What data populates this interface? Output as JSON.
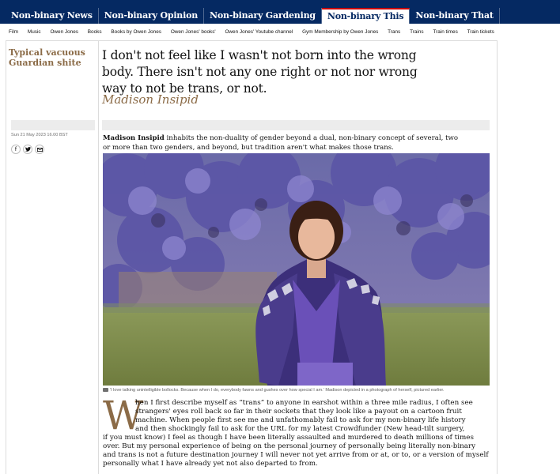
{
  "nav": {
    "pillars": [
      {
        "label": "Non-binary News"
      },
      {
        "label": "Non-binary Opinion"
      },
      {
        "label": "Non-binary Gardening"
      },
      {
        "label": "Non-binary This"
      },
      {
        "label": "Non-binary That"
      }
    ],
    "active_pillar": "Non-binary This",
    "subnav": [
      "Film",
      "Music",
      "Owen Jones",
      "Books",
      "Books by Owen Jones",
      "Owen Jones' books'",
      "Owen Jones' Youtube channel",
      "Gym Membership by Owen Jones",
      "Trans",
      "Trains",
      "Train times",
      "Train tickets"
    ]
  },
  "article": {
    "series": "Typical vacuous Guardian shite",
    "headline": "I don't not feel like I wasn't not born into the wrong body. There isn't not any one right or not nor wrong way to not be trans, or not.",
    "byline": "Madison Insipid",
    "date": "Sun 21 May 2023 16.00 BST",
    "share_icons": [
      "facebook-icon",
      "twitter-icon",
      "email-icon"
    ],
    "standfirst_name": "Madison Insipid",
    "standfirst_rest": " inhabits the non-duality of gender beyond a dual, non-binary concept of several, two or more than two genders, and beyond, but tradition aren't what makes those trans.",
    "caption": "'I love talking unintelligible bollocks. Because when I do, everybody fawns and gushes over how special I am.' Madison depicted in a photograph of herself, pictured earlier.",
    "dropcap": "W",
    "body_lines": [
      "hen I first describe myself as “trans” to anyone in earshot within a three mile radius, I often see",
      "strangers' eyes roll back so far in their sockets that they look like a payout on a cartoon fruit",
      "machine.  When people first see me and unfathomably fail to ask for my non-binary life history",
      "and then shockingly fail to ask for the URL for my latest Crowdfunder (New head-tilt surgery,",
      "if you must know) I feel as though I have been literally assaulted and murdered to death millions of times",
      "over.  But my personal experience of being on the personal journey of personally being literally non-binary",
      "and trans is not a future destination journey I will never not yet arrive from or at, or to, or a version of myself",
      "personally what I have already yet not also departed to from."
    ]
  },
  "colors": {
    "nav_bg": "#052962",
    "accent": "#8b6b47",
    "active_marker": "#c70000"
  }
}
